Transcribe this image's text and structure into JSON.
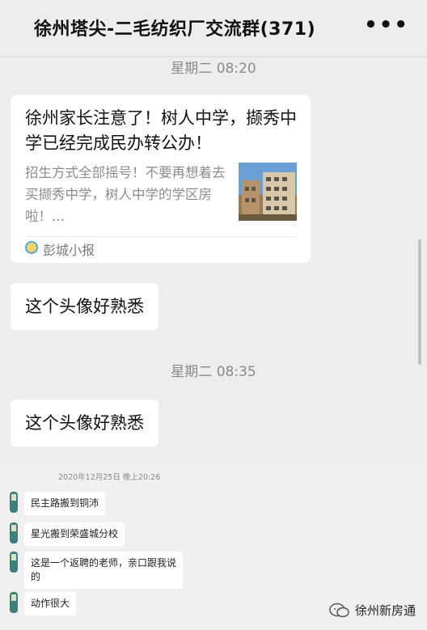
{
  "header": {
    "title": "徐州塔尖-二毛纺织厂交流群(371)",
    "more_icon": "more-dots-icon"
  },
  "timestamps": [
    "星期二 08:20",
    "星期二 08:35"
  ],
  "article_card": {
    "title": "徐州家长注意了！树人中学，撷秀中学已经完成民办转公办！",
    "description": "招生方式全部摇号！不要再想着去买撷秀中学，树人中学的学区房啦！...",
    "source": "彭城小报",
    "thumbnail": "building-photo"
  },
  "messages": [
    "这个头像好熟悉",
    "这个头像好熟悉"
  ],
  "embedded_screenshot": {
    "timestamp": "2020年12月25日 晚上20:26",
    "messages": [
      "民主路搬到铜沛",
      "星光搬到荣盛城分校",
      "这是一个返聘的老师，亲口跟我说的",
      "动作很大"
    ]
  },
  "footer": {
    "label": "徐州新房通",
    "icon": "wechat-icon"
  }
}
